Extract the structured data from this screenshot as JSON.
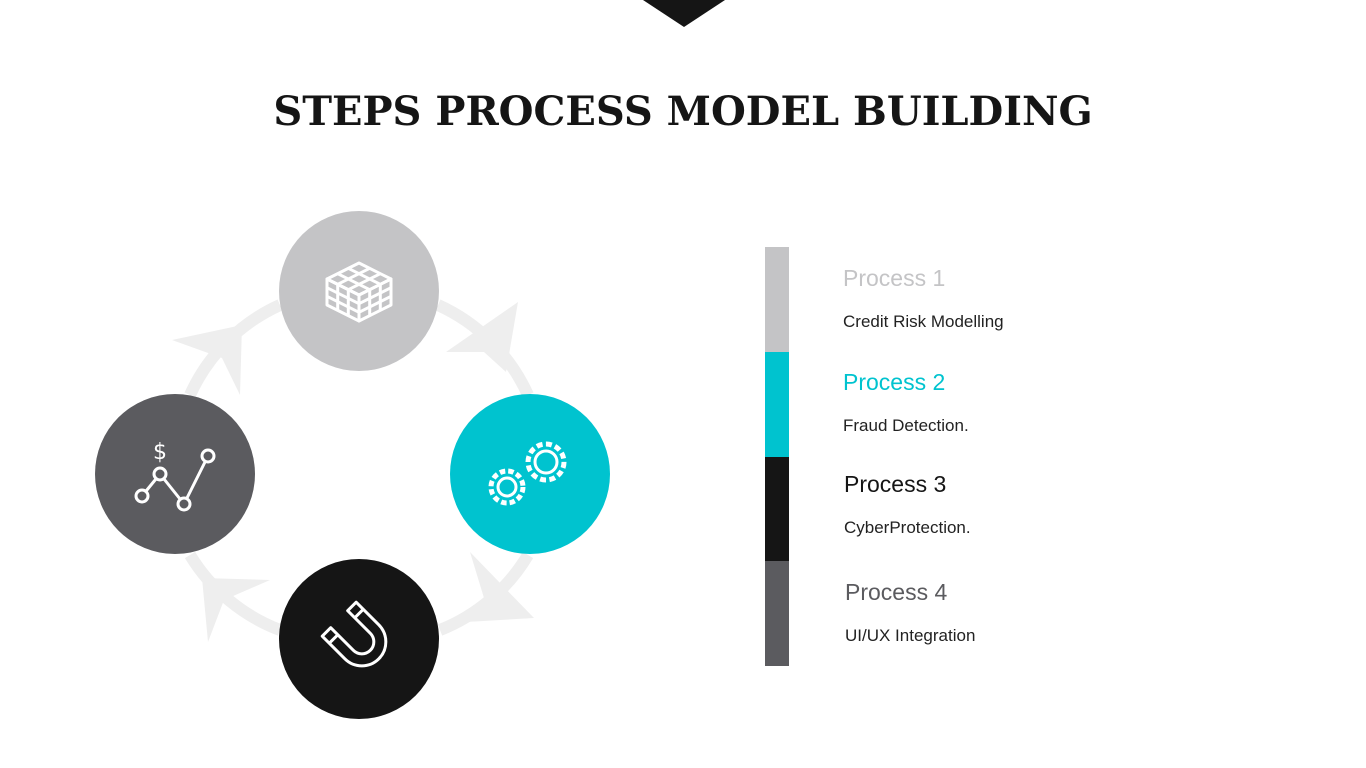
{
  "slide": {
    "title": "STEPS PROCESS MODEL BUILDING"
  },
  "cycle": {
    "steps": [
      {
        "icon": "cube-grid-icon",
        "color": "#c4c4c6"
      },
      {
        "icon": "gears-icon",
        "color": "#00c3cf"
      },
      {
        "icon": "magnet-icon",
        "color": "#151515"
      },
      {
        "icon": "finance-line-chart-icon",
        "color": "#5b5b5f"
      }
    ],
    "arrow_color": "#eeeeee"
  },
  "processes": [
    {
      "title": "Process 1",
      "description": "Credit Risk Modelling",
      "color": "#c4c4c6"
    },
    {
      "title": "Process 2",
      "description": "Fraud Detection.",
      "color": "#00c3cf"
    },
    {
      "title": "Process 3",
      "description": "CyberProtection.",
      "color": "#151515"
    },
    {
      "title": "Process 4",
      "description": "UI/UX Integration",
      "color": "#5b5b5f"
    }
  ]
}
